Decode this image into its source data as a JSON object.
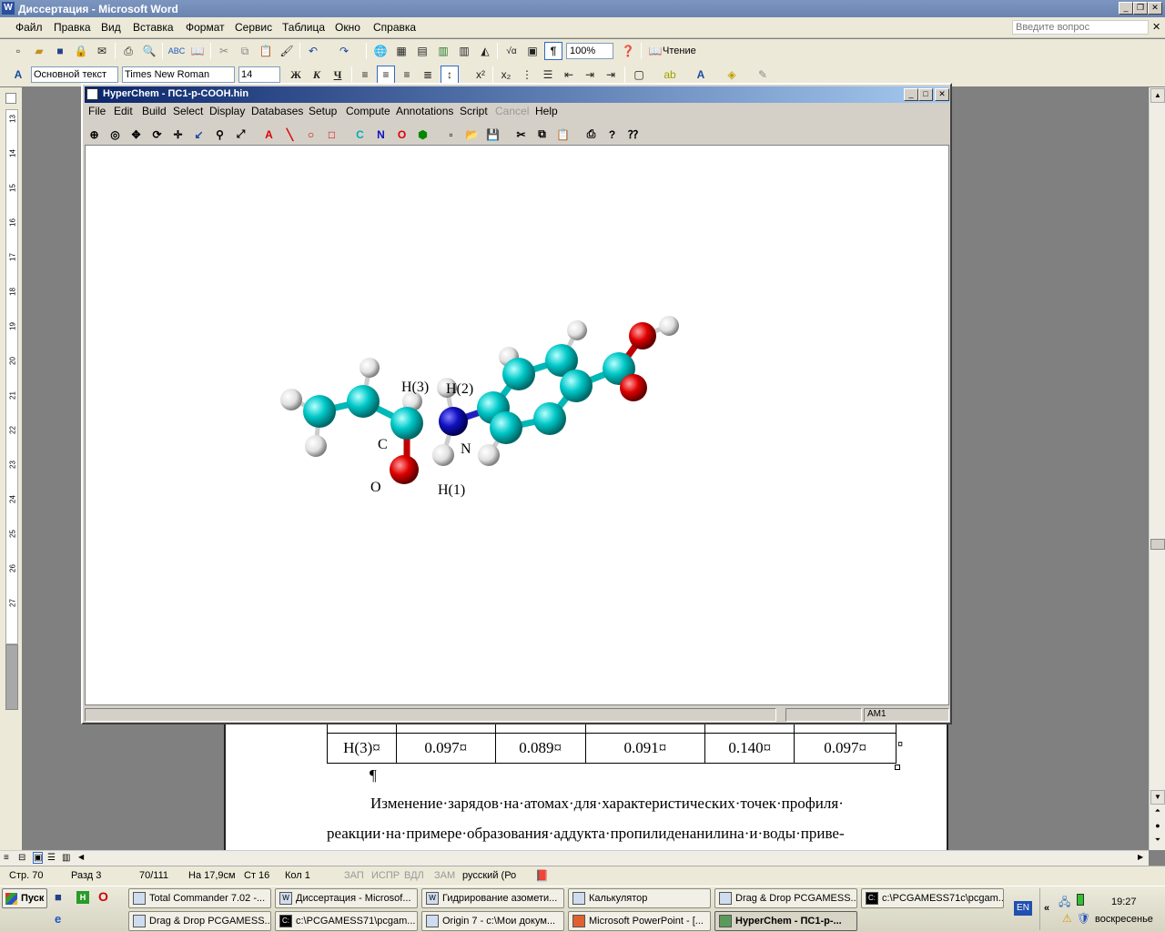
{
  "word": {
    "title": "Диссертация - Microsoft Word",
    "menu": [
      "Файл",
      "Правка",
      "Вид",
      "Вставка",
      "Формат",
      "Сервис",
      "Таблица",
      "Окно",
      "Справка"
    ],
    "help_placeholder": "Введите вопрос",
    "zoom": "100%",
    "reading": "Чтение",
    "style": "Основной текст",
    "font": "Times New Roman",
    "size": "14",
    "bold": "Ж",
    "italic": "К",
    "underline": "Ч",
    "ruler_numbers": [
      "13",
      "14",
      "15",
      "16",
      "17",
      "18",
      "19",
      "20",
      "21",
      "22",
      "23",
      "24",
      "25",
      "26",
      "27"
    ],
    "table_row": {
      "label": "H(3)¤",
      "values": [
        "0.097¤",
        "0.089¤",
        "0.091¤",
        "0.140¤",
        "0.097¤"
      ]
    },
    "pilcrow": "¶",
    "paragraph_line1": "Изменение·зарядов·на·атомах·для·характеристических·точек·профиля·",
    "paragraph_line2": "реакции·на·примере·образования·аддукта·пропилиденанилина·и·воды·приве-",
    "status": {
      "page": "Стр. 70",
      "section": "Разд 3",
      "pages": "70/111",
      "at": "На 17,9см",
      "line": "Ст 16",
      "col": "Кол 1",
      "rec": "ЗАП",
      "trk": "ИСПР",
      "ext": "ВДЛ",
      "ovr": "ЗАМ",
      "lang": "русский (Ро"
    }
  },
  "hyperchem": {
    "title": "HyperChem - ПС1-p-COOH.hin",
    "menu": [
      "File",
      "Edit",
      "Build",
      "Select",
      "Display",
      "Databases",
      "Setup",
      "Compute",
      "Annotations",
      "Script",
      "Cancel",
      "Help"
    ],
    "element_buttons": [
      "C",
      "N",
      "O"
    ],
    "labels": {
      "h3": "H(3)",
      "h2": "H(2)",
      "c": "C",
      "n": "N",
      "o": "O",
      "h1": "H(1)"
    },
    "status_method": "AM1",
    "colors": {
      "carbon": "#00c8c8",
      "nitrogen": "#1010c0",
      "oxygen": "#e00000",
      "hydrogen": "#e8e8e8"
    }
  },
  "taskbar": {
    "start": "Пуск",
    "lang": "EN",
    "time": "19:27",
    "day": "воскресенье",
    "row1": [
      "Total Commander 7.02 -...",
      "Диссертация - Microsof...",
      "Гидрирование азомети...",
      "Калькулятор",
      "Drag & Drop PCGAMESS...",
      "c:\\PCGAMESS71c\\pcgam..."
    ],
    "row2": [
      "Drag & Drop PCGAMESS...",
      "c:\\PCGAMESS71\\pcgam...",
      "Origin 7 - c:\\Мои докум...",
      "Microsoft PowerPoint - [...",
      "HyperChem - ПС1-p-..."
    ]
  }
}
